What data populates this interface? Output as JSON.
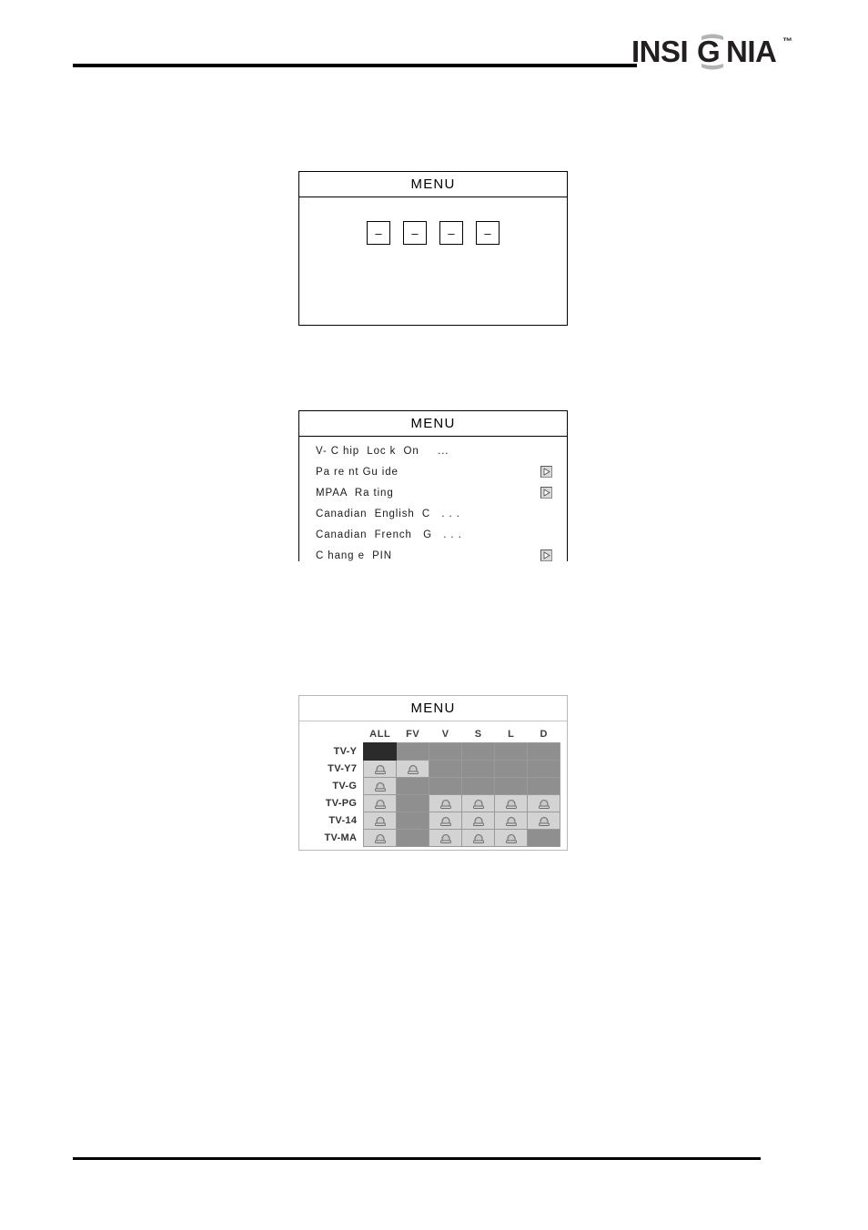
{
  "header": {
    "brand": "INSIGNIA",
    "trademark": "™"
  },
  "menus": [
    {
      "id": "pin-entry",
      "title": "MENU",
      "pin_digits": [
        "–",
        "–",
        "–",
        "–"
      ]
    },
    {
      "id": "vchip-options",
      "title": "MENU",
      "rows": [
        {
          "label": "V- C hip  Loc k",
          "value": "On     ...",
          "arrow": false
        },
        {
          "label": "Pa re nt Gu ide",
          "value": "",
          "arrow": true
        },
        {
          "label": "MPAA  Ra ting",
          "value": "",
          "arrow": true
        },
        {
          "label": "Canadian  English  C   . . .",
          "value": "",
          "arrow": false
        },
        {
          "label": "Canadian  French   G   . . .",
          "value": "",
          "arrow": false
        },
        {
          "label": "C hang e  PIN",
          "value": "",
          "arrow": true
        }
      ]
    },
    {
      "id": "tv-rating-grid",
      "title": "MENU",
      "columns": [
        "ALL",
        "FV",
        "V",
        "S",
        "L",
        "D"
      ],
      "rows": [
        "TV-Y",
        "TV-Y7",
        "TV-G",
        "TV-PG",
        "TV-14",
        "TV-MA"
      ],
      "cells": [
        [
          "cursor",
          "off",
          "off",
          "off",
          "off",
          "off"
        ],
        [
          "locked",
          "locked",
          "off",
          "off",
          "off",
          "off"
        ],
        [
          "locked",
          "off",
          "off",
          "off",
          "off",
          "off"
        ],
        [
          "locked",
          "off",
          "locked",
          "locked",
          "locked",
          "locked"
        ],
        [
          "locked",
          "off",
          "locked",
          "locked",
          "locked",
          "locked"
        ],
        [
          "locked",
          "off",
          "locked",
          "locked",
          "locked",
          "off"
        ]
      ]
    }
  ],
  "colors": {
    "rule": "#000000",
    "cell_off": "#8f8f8f",
    "cell_locked": "#d3d3d3",
    "cell_cursor": "#2b2b2b",
    "logo_dark": "#231f20",
    "logo_gray": "#b3b3b3"
  }
}
